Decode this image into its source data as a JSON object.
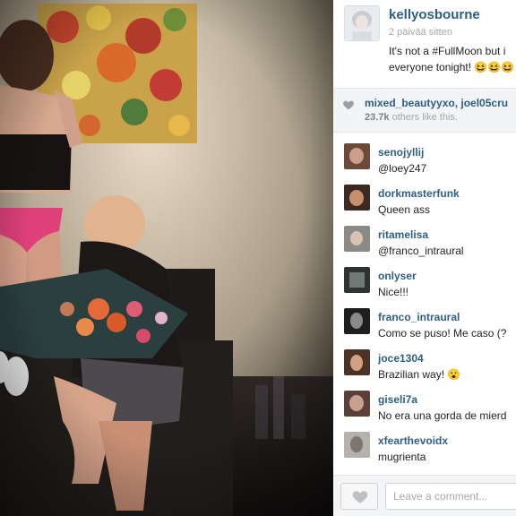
{
  "post": {
    "username": "kellyosbourne",
    "timestamp": "2 päivää sitten",
    "caption_line1": "It's not a #FullMoon but i",
    "caption_line2": "everyone tonight! 😆😆😆"
  },
  "likes": {
    "likers": "mixed_beautyyxo, joel05cru",
    "count": "23.7k",
    "suffix": " others like this."
  },
  "comments": [
    {
      "user": "senojyllij",
      "text": "@loey247"
    },
    {
      "user": "dorkmasterfunk",
      "text": "Queen ass"
    },
    {
      "user": "ritamelisa",
      "text": "@franco_intraural"
    },
    {
      "user": "onlyser",
      "text": "Nice!!!"
    },
    {
      "user": "franco_intraural",
      "text": "Como se puso! Me caso (?"
    },
    {
      "user": "joce1304",
      "text": "Brazilian way! 😮"
    },
    {
      "user": "giseli7a",
      "text": "No era una gorda de mierd"
    },
    {
      "user": "xfearthevoidx",
      "text": "mugrienta"
    }
  ],
  "comment_box": {
    "placeholder": "Leave a comment..."
  },
  "icons": {
    "like_heart": "heart-icon",
    "like_button": "heart-icon"
  },
  "colors": {
    "username": "#2e5e86",
    "muted": "#a5a7aa",
    "bar": "#f3f4f6"
  }
}
